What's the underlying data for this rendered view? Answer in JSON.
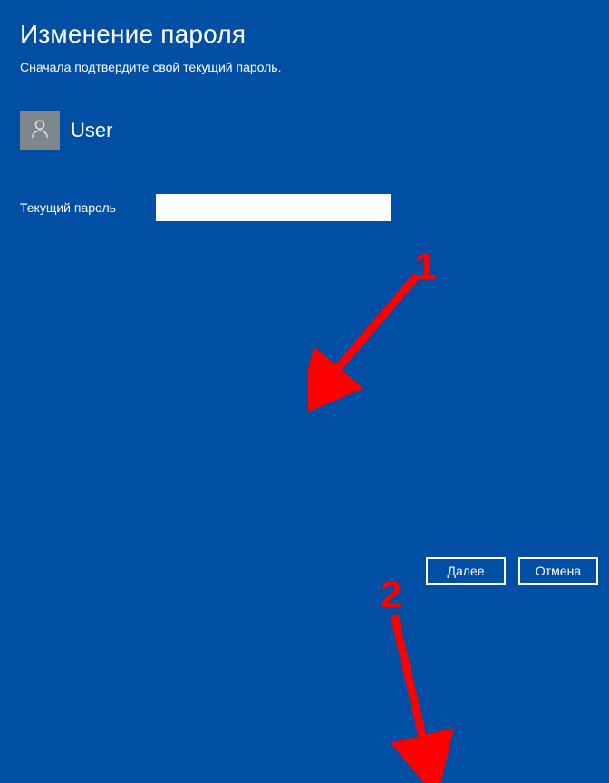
{
  "title": "Изменение пароля",
  "subtitle": "Сначала подтвердите свой текущий пароль.",
  "user": {
    "name": "User"
  },
  "field": {
    "label": "Текущий пароль",
    "value": "",
    "placeholder": ""
  },
  "buttons": {
    "next": "Далее",
    "cancel": "Отмена"
  },
  "annotations": {
    "num1": "1",
    "num2": "2"
  },
  "colors": {
    "background": "#004fa4",
    "annotation": "#ff0000",
    "avatar_bg": "#7f878c"
  }
}
